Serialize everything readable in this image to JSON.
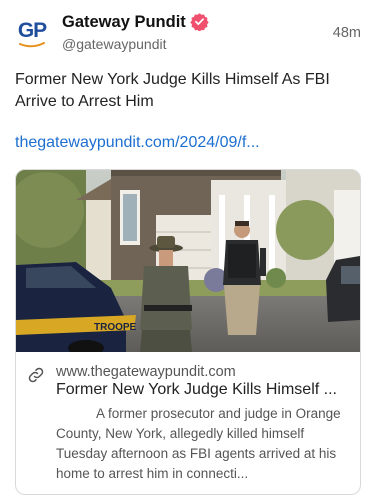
{
  "post": {
    "author": {
      "display_name": "Gateway Pundit",
      "handle": "@gatewaypundit",
      "avatar_text": "GP",
      "verified": true
    },
    "timestamp": "48m",
    "text": "Former New York Judge Kills Himself As FBI Arrive to Arrest Him",
    "link_text": "thegatewaypundit.com/2024/09/f...",
    "link_card": {
      "domain": "www.thegatewaypundit.com",
      "title": "Former New York Judge Kills Himself ...",
      "description": "A former prosecutor and judge in Orange County, New York, allegedly killed himself Tuesday afternoon as FBI agents arrived at his home to arrest him in connecti..."
    }
  },
  "icons": {
    "verified": "verified-badge-icon",
    "link": "link-icon"
  },
  "colors": {
    "link": "#1d6fd1",
    "verified_badge": "#f0506e",
    "avatar_text": "#1f4e9c",
    "avatar_swoosh": "#e8901d"
  }
}
